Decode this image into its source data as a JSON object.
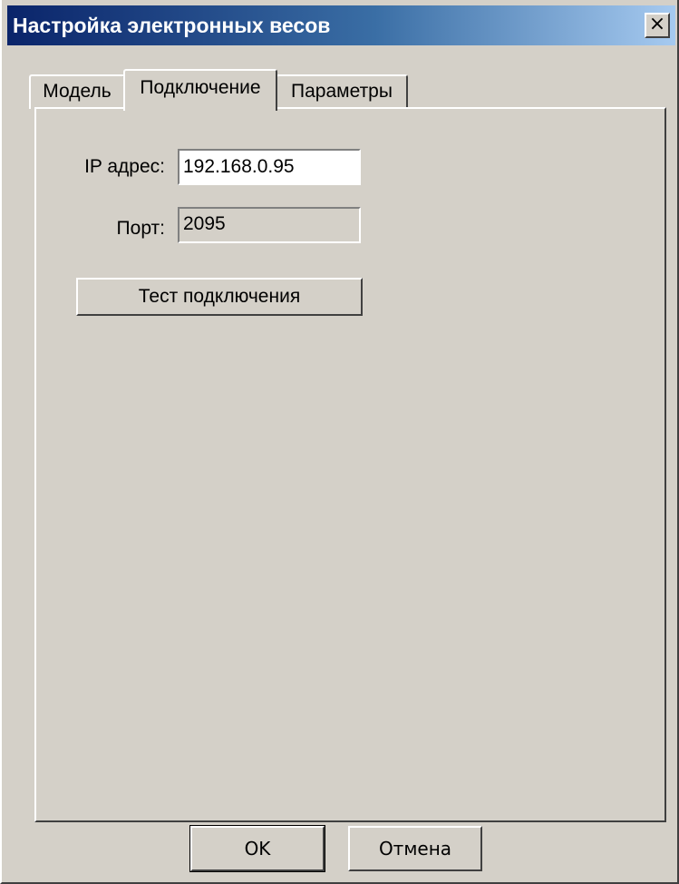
{
  "window": {
    "title": "Настройка электронных весов",
    "close_label": "×"
  },
  "tabs": [
    {
      "label": "Модель",
      "selected": false
    },
    {
      "label": "Подключение",
      "selected": true
    },
    {
      "label": "Параметры",
      "selected": false
    }
  ],
  "connection": {
    "ip_label": "IP адрес:",
    "ip_value": "192.168.0.95",
    "port_label": "Порт:",
    "port_value": "2095",
    "test_button": "Тест подключения"
  },
  "footer": {
    "ok_label": "OK",
    "cancel_label": "Отмена"
  },
  "colors": {
    "titlebar_start": "#0a246a",
    "titlebar_end": "#a6caf0",
    "window_bg": "#d4d0c8"
  }
}
